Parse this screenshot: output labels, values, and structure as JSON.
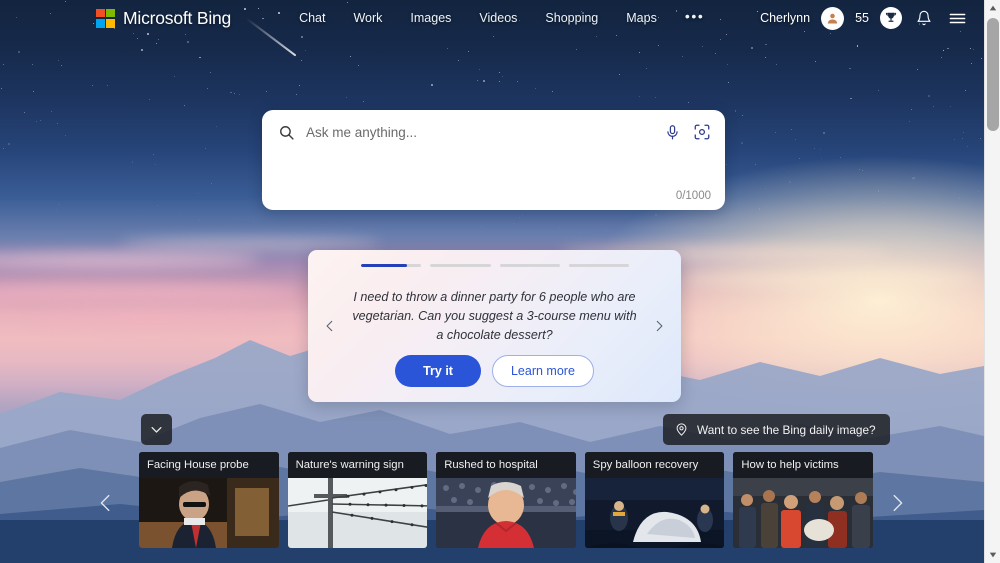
{
  "header": {
    "brand": "Microsoft Bing",
    "nav": [
      {
        "label": "Chat"
      },
      {
        "label": "Work"
      },
      {
        "label": "Images"
      },
      {
        "label": "Videos"
      },
      {
        "label": "Shopping"
      },
      {
        "label": "Maps"
      },
      {
        "label": "•••"
      }
    ],
    "user_name": "Cherlynn",
    "points": "55"
  },
  "search": {
    "placeholder": "Ask me anything...",
    "value": "",
    "counter": "0/1000"
  },
  "suggestion": {
    "text": "I need to throw a dinner party for 6 people who are vegetarian. Can you suggest a 3-course menu with a chocolate dessert?",
    "try_label": "Try it",
    "learn_label": "Learn more",
    "progress": [
      100,
      0,
      0,
      0
    ],
    "active_fill": 76
  },
  "daily_image": {
    "label": "Want to see the Bing daily image?"
  },
  "news": {
    "cards": [
      {
        "title": "Facing House probe"
      },
      {
        "title": "Nature's warning sign"
      },
      {
        "title": "Rushed to hospital"
      },
      {
        "title": "Spy balloon recovery"
      },
      {
        "title": "How to help victims"
      }
    ]
  },
  "colors": {
    "accent_blue": "#2b55d8",
    "progress_blue": "#2340b8",
    "logo_red": "#f25022",
    "logo_green": "#7fba00",
    "logo_blue": "#00a4ef",
    "logo_yellow": "#ffb900"
  }
}
